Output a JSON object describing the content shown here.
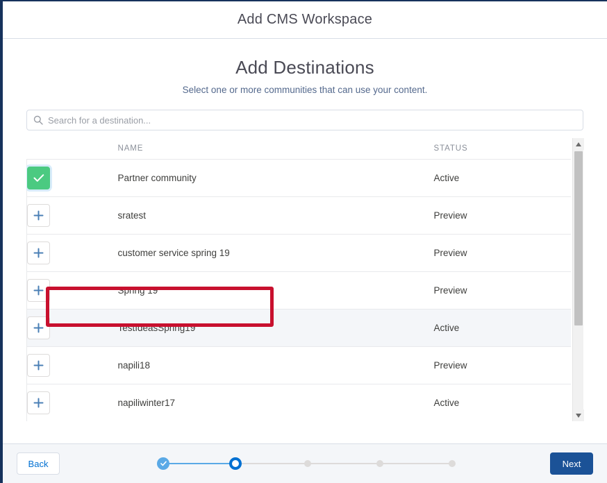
{
  "window": {
    "modal_title": "Add CMS Workspace"
  },
  "page": {
    "heading": "Add Destinations",
    "subheading": "Select one or more communities that can use your content."
  },
  "search": {
    "placeholder": "Search for a destination...",
    "value": "",
    "icon": "search-icon"
  },
  "table": {
    "columns": {
      "action": "",
      "name": "NAME",
      "status": "STATUS"
    },
    "rows": [
      {
        "name": "Partner community",
        "status": "Active",
        "selected": true,
        "action_icon": "check-icon",
        "hover": false
      },
      {
        "name": "sratest",
        "status": "Preview",
        "selected": false,
        "action_icon": "plus-icon",
        "hover": false
      },
      {
        "name": "customer service spring 19",
        "status": "Preview",
        "selected": false,
        "action_icon": "plus-icon",
        "hover": false
      },
      {
        "name": "Spring 19",
        "status": "Preview",
        "selected": false,
        "action_icon": "plus-icon",
        "hover": false
      },
      {
        "name": "TestIdeasSpring19",
        "status": "Active",
        "selected": false,
        "action_icon": "plus-icon",
        "hover": true
      },
      {
        "name": "napili18",
        "status": "Preview",
        "selected": false,
        "action_icon": "plus-icon",
        "hover": false
      },
      {
        "name": "napiliwinter17",
        "status": "Active",
        "selected": false,
        "action_icon": "plus-icon",
        "hover": false
      }
    ]
  },
  "scrollbar": {
    "up_icon": "triangle-up-icon",
    "down_icon": "triangle-down-icon",
    "thumb_position_percent": 0,
    "thumb_size_percent": 67
  },
  "annotation": {
    "color": "#c8102e",
    "target": "Partner community"
  },
  "footer": {
    "back_label": "Back",
    "next_label": "Next",
    "progress": {
      "total_steps": 5,
      "current_step": 2,
      "steps": [
        {
          "state": "done"
        },
        {
          "state": "active"
        },
        {
          "state": "todo"
        },
        {
          "state": "todo"
        },
        {
          "state": "todo"
        }
      ]
    }
  },
  "colors": {
    "accent_blue": "#0070d2",
    "primary_button": "#1b5297",
    "selected_green": "#4bca81",
    "annotation_red": "#c8102e"
  }
}
